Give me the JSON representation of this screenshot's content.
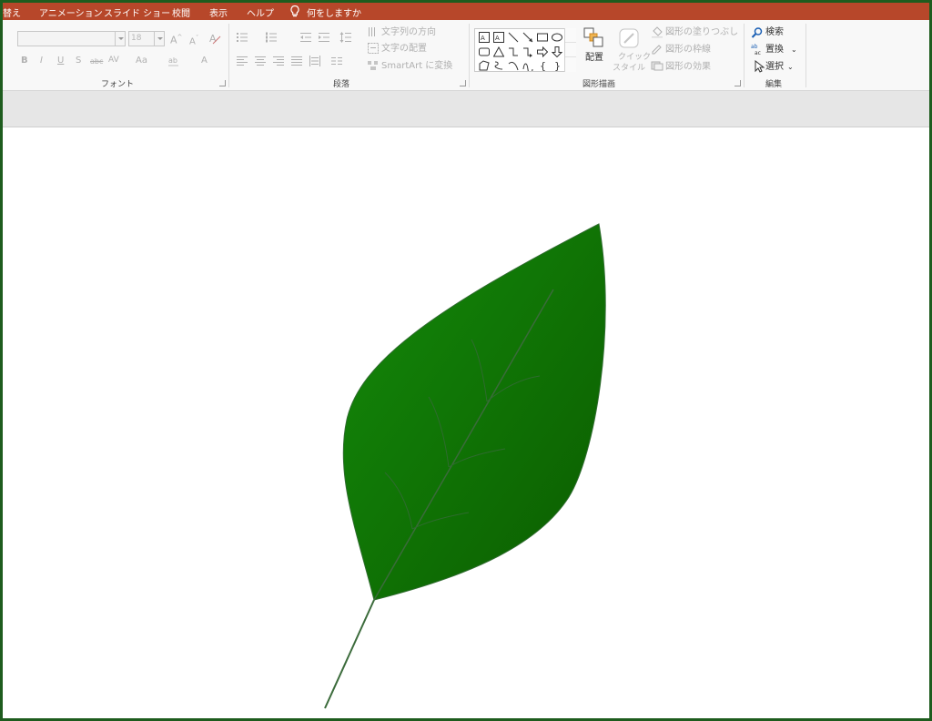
{
  "menu": {
    "items": [
      "替え",
      "アニメーション",
      "スライド ショー",
      "校閲",
      "表示",
      "ヘルプ"
    ],
    "tell_me": "何をしますか"
  },
  "ribbon": {
    "font": {
      "group_label": "フォント",
      "font_size": "18",
      "bold": "B",
      "italic": "I",
      "underline": "U",
      "shadow": "S",
      "strike": "abc",
      "spacing": "AV",
      "case": "Aa",
      "color": "A"
    },
    "paragraph": {
      "group_label": "段落",
      "text_direction": "文字列の方向",
      "align_text": "文字の配置",
      "smartart": "SmartArt に変換"
    },
    "drawing": {
      "group_label": "図形描画",
      "arrange": "配置",
      "quick_style_1": "クイック",
      "quick_style_2": "スタイル",
      "shape_fill": "図形の塗りつぶし",
      "shape_outline": "図形の枠線",
      "shape_effects": "図形の効果"
    },
    "editing": {
      "group_label": "編集",
      "find": "検索",
      "replace": "置換",
      "select": "選択"
    }
  },
  "colors": {
    "menubar": "#b7472a",
    "frame": "#1e5c1e",
    "leaf_light": "#148a0a",
    "leaf_dark": "#0b5c00",
    "vein": "#3b6b3b"
  },
  "slide": {
    "shape": "leaf-icon"
  }
}
